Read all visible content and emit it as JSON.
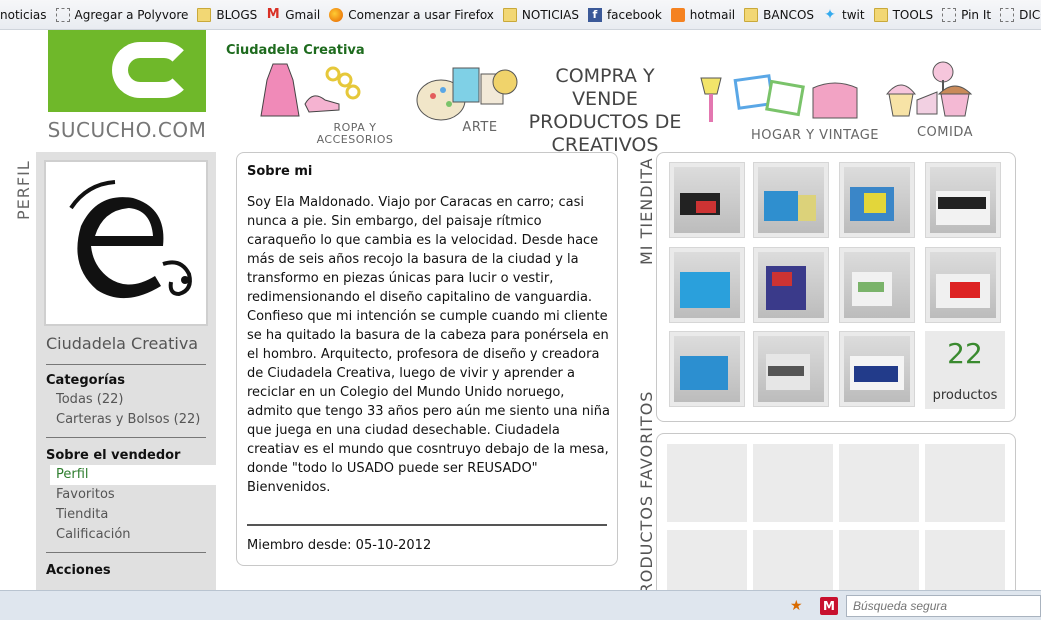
{
  "bookmarks": [
    {
      "label": "noticias",
      "icon": "none"
    },
    {
      "label": "Agregar a Polyvore",
      "icon": "page-icon"
    },
    {
      "label": "BLOGS",
      "icon": "folder-icon"
    },
    {
      "label": "Gmail",
      "icon": "gmail-icon"
    },
    {
      "label": "Comenzar a usar Firefox",
      "icon": "firefox-icon"
    },
    {
      "label": "NOTICIAS",
      "icon": "folder-icon"
    },
    {
      "label": "facebook",
      "icon": "facebook-icon"
    },
    {
      "label": "hotmail",
      "icon": "hotmail-icon"
    },
    {
      "label": "BANCOS",
      "icon": "folder-icon"
    },
    {
      "label": "twit",
      "icon": "twitter-icon"
    },
    {
      "label": "TOOLS",
      "icon": "folder-icon"
    },
    {
      "label": "Pin It",
      "icon": "page-icon"
    },
    {
      "label": "DICCIONARIO",
      "icon": "page-icon"
    }
  ],
  "header": {
    "logo_text": "SUCUCHO.COM",
    "shop_title": "Ciudadela Creativa",
    "headline": "COMPRA Y VENDE PRODUCTOS DE CREATIVOS",
    "categories": {
      "ropa": "ROPA Y ACCESORIOS",
      "arte": "ARTE",
      "hogar": "HOGAR Y VINTAGE",
      "comida": "COMIDA"
    }
  },
  "sidebar": {
    "section_label": "PERFIL",
    "name": "Ciudadela Creativa",
    "categorias_title": "Categorías",
    "categorias": [
      "Todas (22)",
      "Carteras y Bolsos (22)"
    ],
    "vendedor_title": "Sobre el vendedor",
    "vendedor_items": [
      "Perfil",
      "Favoritos",
      "Tiendita",
      "Calificación"
    ],
    "acciones_title": "Acciones"
  },
  "about": {
    "title": "Sobre mi",
    "body": "Soy Ela Maldonado. Viajo por Caracas en carro; casi nunca a pie. Sin embargo, del paisaje rítmico caraqueño lo que cambia es la velocidad. Desde hace más de seis años recojo la basura de la ciudad y la transformo en piezas únicas para lucir o vestir, redimensionando el diseño capitalino de vanguardia. Confieso que mi intención se cumple cuando mi cliente se ha quitado la basura de la cabeza para ponérsela en el hombro. Arquitecto, profesora de diseño y creadora de Ciudadela Creativa, luego de vivir y aprender a reciclar en un Colegio del Mundo Unido noruego, admito que tengo 33 años pero aún me siento una niña que juega en una ciudad desechable. Ciudadela creatiav es el mundo que cosntruyo debajo de la mesa, donde \"todo lo USADO puede ser REUSADO\" Bienvenidos.",
    "member_since": "Miembro desde: 05-10-2012"
  },
  "tiendita": {
    "label": "MI TIENDITA",
    "count": "22",
    "count_label": "productos"
  },
  "favoritos": {
    "label": "PRODUCTOS FAVORITOS"
  },
  "statusbar": {
    "search_placeholder": "Búsqueda segura"
  }
}
